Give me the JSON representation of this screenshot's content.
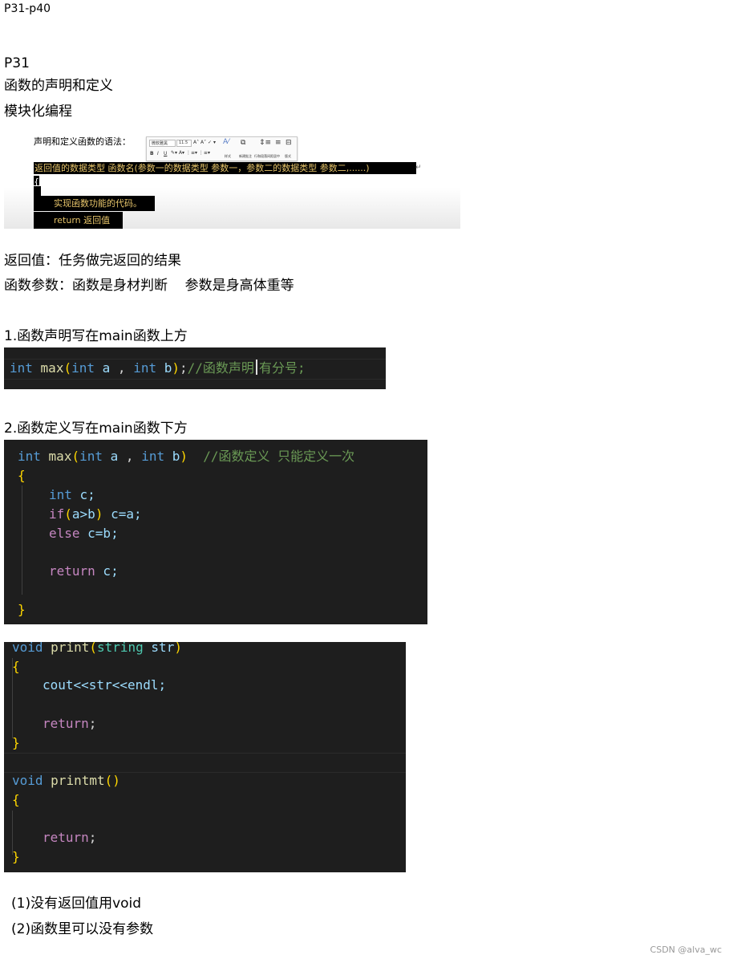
{
  "header": {
    "range": "P31-p40"
  },
  "section": {
    "title": "P31",
    "subtitle1": "函数的声明和定义",
    "subtitle2": "模块化编程"
  },
  "screenshot": {
    "label": "声明和定义函数的语法：",
    "toolbar": {
      "font_name": "微软雅黑",
      "font_size": "11.5",
      "btn_bold": "B",
      "btn_italic": "I",
      "btn_underline": "U",
      "btn_style": "样式",
      "btn_new_comment": "新建批注",
      "btn_line_spacing": "行和段落间距",
      "btn_center": "居中",
      "btn_layout": "版式"
    },
    "line1": "返回值的数据类型  函数名(参数一的数据类型  参数一，参数二的数据类型  参数二,......)",
    "line2": "{",
    "line3": "实现函数功能的代码。",
    "line4": "return  返回值",
    "mark": "↵"
  },
  "notes": {
    "return_value": "返回值：任务做完返回的结果",
    "params": "函数参数：函数是身材判断    参数是身高体重等"
  },
  "step1": {
    "heading": "1.函数声明写在main函数上方",
    "code": {
      "kw1": "int",
      "fn": "max",
      "p_open": "(",
      "kw2": "int",
      "a": "a",
      "comma": " , ",
      "kw3": "int",
      "b": "b",
      "p_close": ")",
      "semi": ";",
      "comment1": "//函数声明",
      "comment2": "有分号;"
    }
  },
  "step2": {
    "heading": "2.函数定义写在main函数下方",
    "code": {
      "l1_kw": "int",
      "l1_fn": "max",
      "l1_po": "(",
      "l1_kw2": "int",
      "l1_a": "a",
      "l1_comma": " , ",
      "l1_kw3": "int",
      "l1_b": "b",
      "l1_pc": ")",
      "l1_comment": "//函数定义 只能定义一次",
      "l2": "{",
      "l3_kw": "int",
      "l3_rest": "c;",
      "l4_if": "if",
      "l4_po": "(",
      "l4_cond": "a>b",
      "l4_pc": ")",
      "l4_rest": " c=a;",
      "l5_else": "else",
      "l5_rest": " c=b;",
      "l6_ret": "return",
      "l6_rest": " c;",
      "l7": "}"
    }
  },
  "code3": {
    "f1_kw": "void",
    "f1_fn": "print",
    "f1_po": "(",
    "f1_type": "string",
    "f1_param": "str",
    "f1_pc": ")",
    "f1_ob": "{",
    "f1_body": "cout<<str<<endl;",
    "f1_ret": "return",
    "f1_semi": ";",
    "f1_cb": "}",
    "f2_kw": "void",
    "f2_fn": "printmt",
    "f2_paren": "()",
    "f2_ob": "{",
    "f2_ret": "return",
    "f2_semi": ";",
    "f2_cb": "}"
  },
  "footer_notes": {
    "n1": "(1)没有返回值用void",
    "n2": "(2)函数里可以没有参数"
  },
  "watermark": "CSDN @alva_wc"
}
